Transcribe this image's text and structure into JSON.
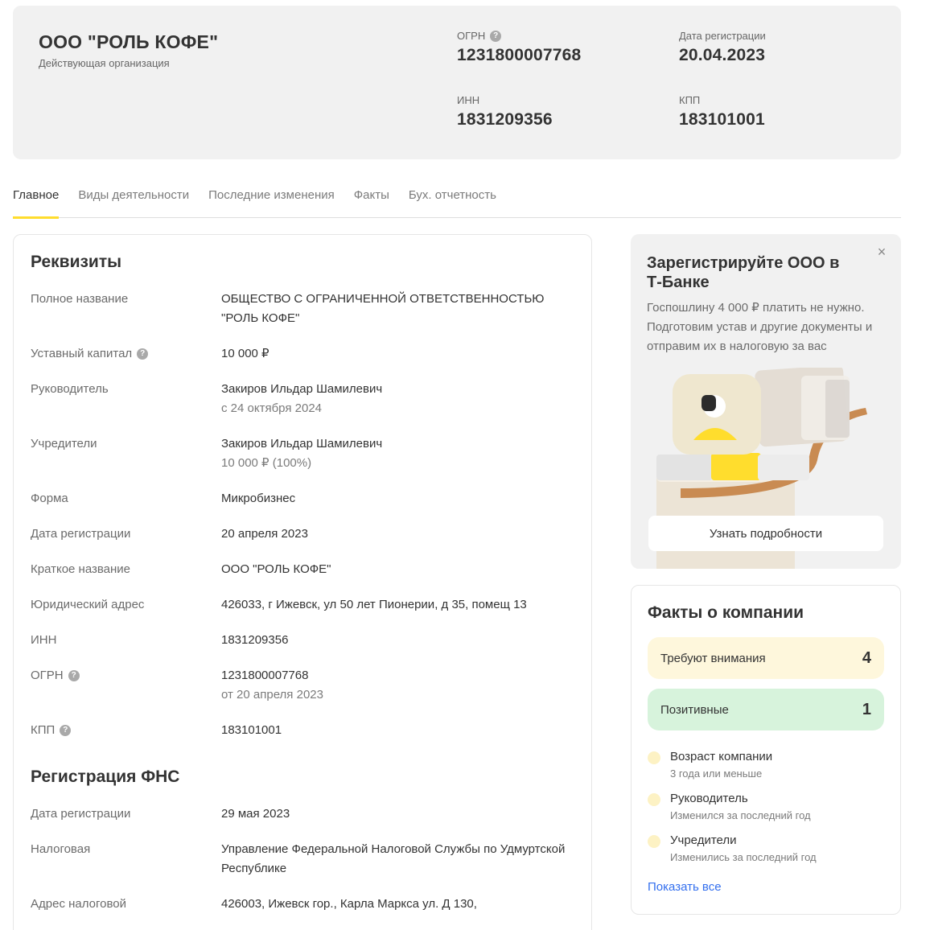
{
  "header": {
    "company_name": "ООО \"РОЛЬ КОФЕ\"",
    "status": "Действующая организация",
    "ogrn_label": "ОГРН",
    "ogrn_value": "1231800007768",
    "reg_date_label": "Дата регистрации",
    "reg_date_value": "20.04.2023",
    "inn_label": "ИНН",
    "inn_value": "1831209356",
    "kpp_label": "КПП",
    "kpp_value": "183101001"
  },
  "tabs": [
    {
      "label": "Главное",
      "active": true
    },
    {
      "label": "Виды деятельности",
      "active": false
    },
    {
      "label": "Последние изменения",
      "active": false
    },
    {
      "label": "Факты",
      "active": false
    },
    {
      "label": "Бух. отчетность",
      "active": false
    }
  ],
  "requisites": {
    "title": "Реквизиты",
    "rows": [
      {
        "label": "Полное название",
        "value": "ОБЩЕСТВО С ОГРАНИЧЕННОЙ ОТВЕТСТВЕННОСТЬЮ \"РОЛЬ КОФЕ\""
      },
      {
        "label": "Уставный капитал",
        "value": "10 000 ₽"
      },
      {
        "label": "Руководитель",
        "value": "Закиров Ильдар Шамилевич",
        "sub": "с 24 октября 2024"
      },
      {
        "label": "Учредители",
        "value": "Закиров Ильдар Шамилевич",
        "sub": "10 000 ₽ (100%)"
      },
      {
        "label": "Форма",
        "value": "Микробизнес"
      },
      {
        "label": "Дата регистрации",
        "value": "20 апреля 2023"
      },
      {
        "label": "Краткое название",
        "value": "ООО \"РОЛЬ КОФЕ\""
      },
      {
        "label": "Юридический адрес",
        "value": "426033, г Ижевск, ул 50 лет Пионерии, д 35, помещ 13"
      },
      {
        "label": "ИНН",
        "value": "1831209356"
      },
      {
        "label": "ОГРН",
        "value": "1231800007768",
        "sub": "от 20 апреля 2023"
      },
      {
        "label": "КПП",
        "value": "183101001"
      }
    ]
  },
  "fns": {
    "title": "Регистрация ФНС",
    "rows": [
      {
        "label": "Дата регистрации",
        "value": "29 мая 2023"
      },
      {
        "label": "Налоговая",
        "value": "Управление Федеральной Налоговой Службы по Удмуртской Республике"
      },
      {
        "label": "Адрес налоговой",
        "value": "426003, Ижевск гор., Карла Маркса ул. Д 130,"
      }
    ]
  },
  "promo": {
    "title": "Зарегистрируйте ООО в Т-Банке",
    "text": "Госпошлину 4 000 ₽ платить не нужно. Подготовим устав и другие документы и отправим их в налоговую за вас",
    "button": "Узнать подробности",
    "close": "×"
  },
  "facts": {
    "title": "Факты о компании",
    "attention_label": "Требуют внимания",
    "attention_count": "4",
    "positive_label": "Позитивные",
    "positive_count": "1",
    "items": [
      {
        "title": "Возраст компании",
        "sub": "3 года или меньше"
      },
      {
        "title": "Руководитель",
        "sub": "Изменился за последний год"
      },
      {
        "title": "Учредители",
        "sub": "Изменились за последний год"
      }
    ],
    "show_all": "Показать все"
  },
  "colors": {
    "accent": "#ffdd2d",
    "link": "#336fee",
    "warn_bg": "#fef7dc",
    "positive_bg": "#d7f3dc"
  }
}
